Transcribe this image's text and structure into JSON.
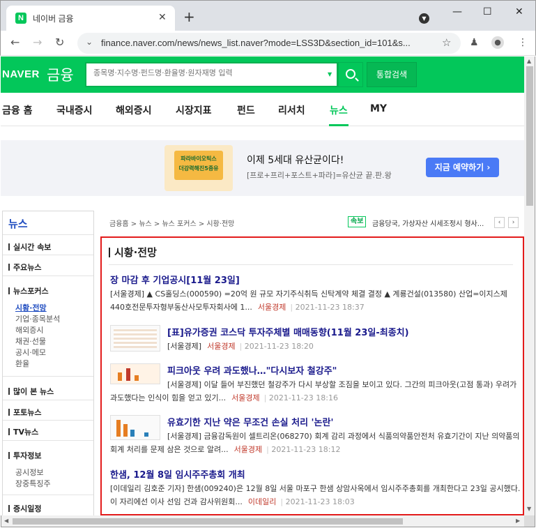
{
  "browser": {
    "tab_title": "네이버 금융",
    "tab_favicon": "N",
    "url": "finance.naver.com/news/news_list.naver?mode=LSS3D&section_id=101&s..."
  },
  "header": {
    "logo": "NAVER",
    "logo_sub": "금융",
    "search_placeholder": "종목명·지수명·펀드명·환율명·원자재명 입력",
    "total_search": "통합검색"
  },
  "gnb": [
    "금융 홈",
    "국내증시",
    "해외증시",
    "시장지표",
    "펀드",
    "리서치",
    "뉴스",
    "MY"
  ],
  "gnb_active_index": 6,
  "banner": {
    "img_text": "파라바이오틱스\n더강력해진5중유",
    "title": "이제 5세대 유산균이다!",
    "subtitle": "[프로+프리+포스트+파라]=유산균 끝.판.왕",
    "button": "지금 예약하기 ›"
  },
  "lnb": {
    "title": "뉴스",
    "sections": [
      {
        "label": "실시간 속보",
        "subs": []
      },
      {
        "label": "주요뉴스",
        "subs": []
      },
      {
        "label": "뉴스포커스",
        "subs": [
          "시황·전망",
          "기업·종목분석",
          "해외증시",
          "채권·선물",
          "공시·메모",
          "환율"
        ]
      },
      {
        "label": "많이 본 뉴스",
        "subs": []
      },
      {
        "label": "포토뉴스",
        "subs": []
      },
      {
        "label": "TV뉴스",
        "subs": []
      },
      {
        "label": "투자정보",
        "subs": [
          "공시정보",
          "장중특징주"
        ]
      },
      {
        "label": "증시일정",
        "subs": []
      }
    ]
  },
  "breadcrumb": "금융홈 > 뉴스 > 뉴스 포커스 > 시황·전망",
  "flash": {
    "badge": "속보",
    "text": "금융당국, 가상자산 시세조정시 형사..."
  },
  "section_title": "시황·전망",
  "articles": [
    {
      "title": "장 마감 후 기업공시[11월 23일]",
      "summary": "[서울경제] ▲ CS홀딩스(000590) =20억 원 규모 자기주식취득 신탁계약 체결 결정 ▲ 계룡건설(013580) 산업=이지스제440호전문투자형부동산사모투자회사에 1...",
      "press": "서울경제",
      "date": "2021-11-23 18:37",
      "thumb": false
    },
    {
      "title": "[표]유가증권 코스닥 투자주체별 매매동향(11월 23일-최종치)",
      "summary": "[서울경제]",
      "press": "서울경제",
      "date": "2021-11-23 18:20",
      "thumb": true
    },
    {
      "title": "피크아웃 우려 과도했나…\"다시보자 철강주\"",
      "summary": "[서울경제] 이달 들어 부진했던 철강주가 다시 부상할 조짐을 보이고 있다. 그간의 피크아웃(고점 통과) 우려가 과도했다는 인식이 힘을 얻고 있기...",
      "press": "서울경제",
      "date": "2021-11-23 18:16",
      "thumb": true
    },
    {
      "title": "유효기한 지난 약은 무조건 손실 처리 '논란'",
      "summary": "[서울경제] 금융감독원이 셀트리온(068270) 회계 감리 과정에서 식품의약품안전처 유효기간이 지난 의약품의 회계 처리를 문제 삼은 것으로 알려...",
      "press": "서울경제",
      "date": "2021-11-23 18:12",
      "thumb": true
    },
    {
      "title": "한샘, 12월 8일 임시주주총회 개최",
      "summary": "[이데일리 김호준 기자] 한샘(009240)은 12월 8일 서울 마포구 한샘 상암사옥에서 임시주주총회를 개최한다고 23일 공시했다. 이 자리에선 이사 선임 건과 감사위원회...",
      "press": "이데일리",
      "date": "2021-11-23 18:03",
      "thumb": false
    }
  ],
  "colors": {
    "naver_green": "#03c75a",
    "highlight_red": "#e31b1b",
    "link_blue": "#1a1a8c",
    "press_red": "#c0392b"
  }
}
